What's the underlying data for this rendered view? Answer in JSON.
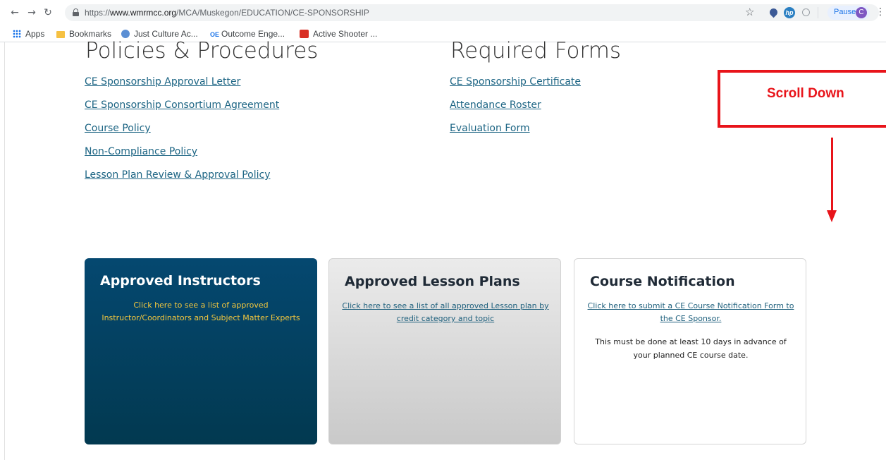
{
  "browser": {
    "url_prefix": "https://",
    "url_domain": "www.wmrmcc.org",
    "url_path": "/MCA/Muskegon/EDUCATION/CE-SPONSORSHIP",
    "paused_label": "Paused",
    "avatar_initial": "C",
    "bookmarks": [
      {
        "label": "Apps",
        "icon": "apps-icon"
      },
      {
        "label": "Bookmarks",
        "icon": "folder-icon"
      },
      {
        "label": "Just Culture Ac...",
        "icon": "globe-icon"
      },
      {
        "label": "Outcome Enge...",
        "icon": "oe-icon",
        "icon_text": "OE"
      },
      {
        "label": "Active Shooter ...",
        "icon": "shooter-icon"
      }
    ]
  },
  "policies": {
    "heading": "Policies & Procedures",
    "links": [
      "CE Sponsorship Approval Letter",
      "CE Sponsorship Consortium Agreement",
      "Course Policy",
      "Non-Compliance Policy",
      "Lesson Plan Review & Approval Policy"
    ]
  },
  "forms": {
    "heading": "Required Forms",
    "links": [
      "CE Sponsorship Certificate",
      "Attendance Roster",
      "Evaluation Form"
    ]
  },
  "callout": {
    "text": "Scroll Down",
    "color": "#e8141a"
  },
  "cards": [
    {
      "title": "Approved Instructors",
      "link_lines": [
        "Click here to see a list of approved",
        "Instructor/Coordinators and Subject Matter Experts"
      ],
      "color": "#054870"
    },
    {
      "title": "Approved Lesson Plans",
      "link_lines": [
        "Click here to see a list of all approved Lesson plan by",
        "credit category and topic"
      ]
    },
    {
      "title": "Course Notification",
      "link_lines": [
        "Click here to submit a CE Course Notification Form to",
        "the CE Sponsor."
      ],
      "note_lines": [
        "This must be done at least 10 days in advance of",
        "your planned CE course date."
      ]
    }
  ],
  "colors": {
    "link": "#1d6584",
    "instructor_link": "#f3c73e"
  }
}
